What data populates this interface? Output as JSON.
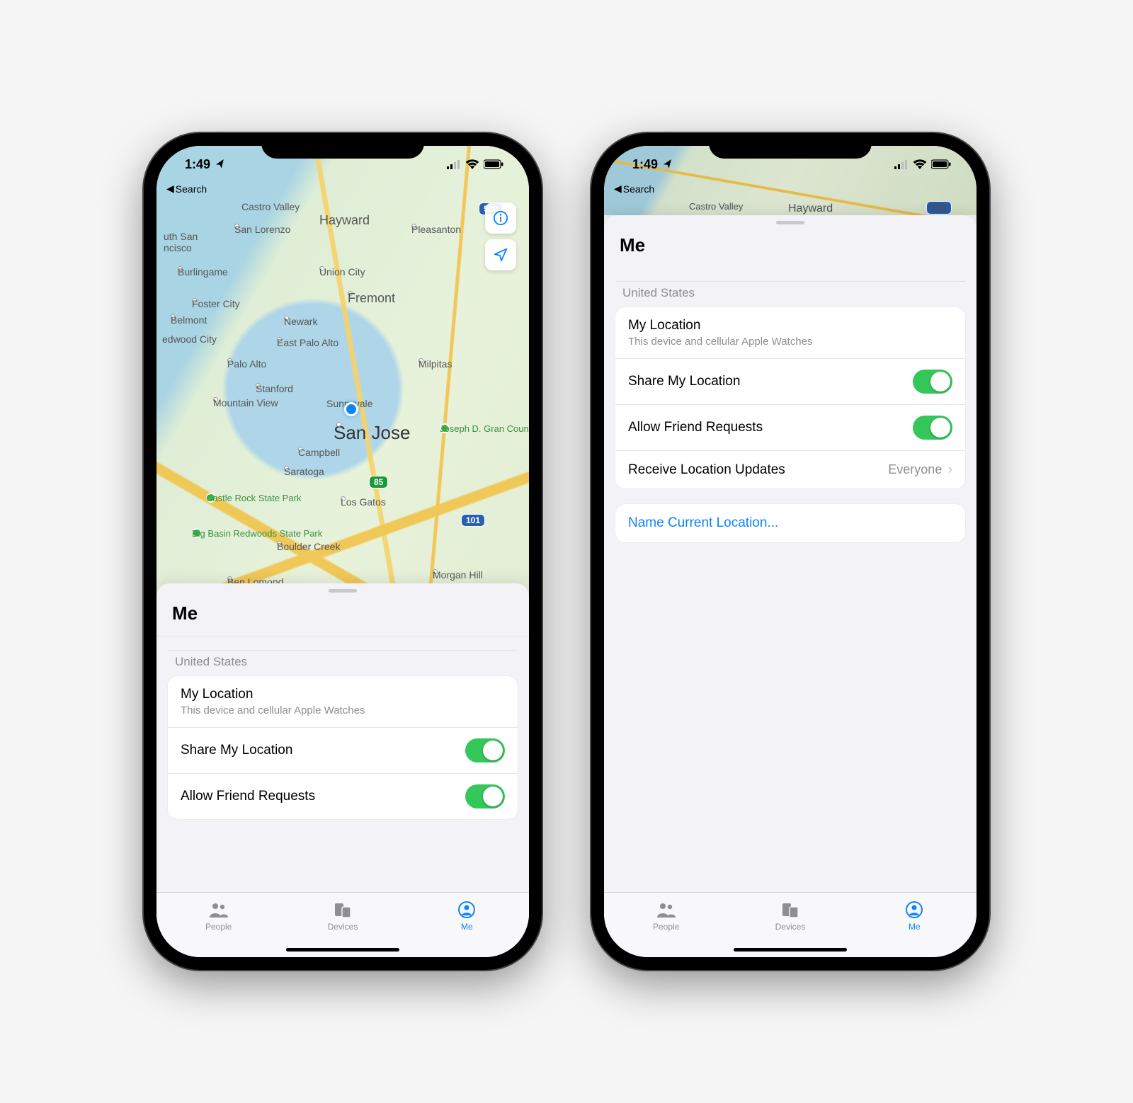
{
  "status": {
    "time": "1:49",
    "location_arrow": "➤",
    "back_label": "Search"
  },
  "map": {
    "cities": {
      "castro_valley": "Castro Valley",
      "hayward": "Hayward",
      "san_lorenzo": "San Lorenzo",
      "pleasanton": "Pleasanton",
      "south_sf": "uth San\nncisco",
      "burlingame": "Burlingame",
      "union_city": "Union City",
      "foster_city": "Foster City",
      "fremont": "Fremont",
      "belmont": "Belmont",
      "newark": "Newark",
      "redwood_city": "edwood City",
      "east_palo_alto": "East Palo Alto",
      "palo_alto": "Palo Alto",
      "milpitas": "Milpitas",
      "stanford": "Stanford",
      "mountain_view": "Mountain View",
      "sunnyvale": "Sunnyvale",
      "san_jose": "San Jose",
      "campbell": "Campbell",
      "saratoga": "Saratoga",
      "los_gatos": "Los Gatos",
      "boulder_creek": "Boulder Creek",
      "ben_lomond": "Ben Lomond",
      "morgan_hill": "Morgan Hill"
    },
    "parks": {
      "joseph_grant": "Joseph D. Gran\nCounty Park",
      "castle_rock": "Castle Rock\nState Park",
      "big_basin": "Big Basin\nRedwoods\nState Park"
    },
    "highways": {
      "h580": "580",
      "h85": "85",
      "h101": "101"
    }
  },
  "sheet": {
    "title": "Me",
    "section_label": "United States",
    "rows": {
      "my_location": {
        "title": "My Location",
        "subtitle": "This device and cellular Apple Watches"
      },
      "share_location": {
        "title": "Share My Location"
      },
      "friend_requests": {
        "title": "Allow Friend Requests"
      },
      "receive_updates": {
        "title": "Receive Location Updates",
        "value": "Everyone"
      },
      "name_location": {
        "title": "Name Current Location..."
      }
    }
  },
  "tabs": {
    "people": "People",
    "devices": "Devices",
    "me": "Me"
  }
}
